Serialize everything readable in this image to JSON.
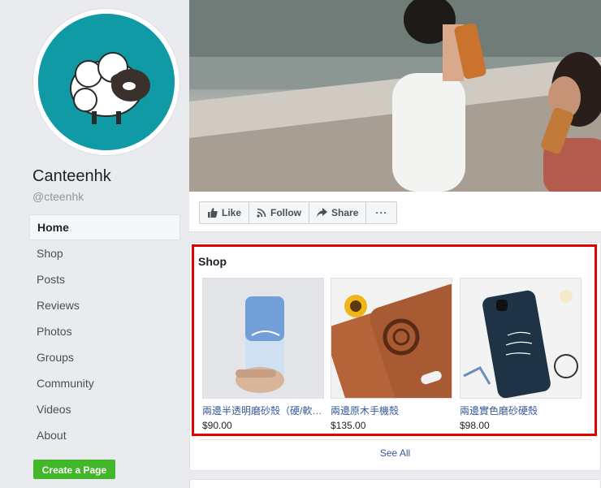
{
  "page": {
    "name": "Canteenhk",
    "handle": "@cteenhk"
  },
  "nav": {
    "items": [
      {
        "label": "Home",
        "active": true
      },
      {
        "label": "Shop"
      },
      {
        "label": "Posts"
      },
      {
        "label": "Reviews"
      },
      {
        "label": "Photos"
      },
      {
        "label": "Groups"
      },
      {
        "label": "Community"
      },
      {
        "label": "Videos"
      },
      {
        "label": "About"
      }
    ],
    "create_page_label": "Create a Page"
  },
  "actions": {
    "like_label": "Like",
    "follow_label": "Follow",
    "share_label": "Share",
    "more_label": "···"
  },
  "shop": {
    "title": "Shop",
    "products": [
      {
        "name": "兩邊半透明磨砂殼（硬/軟…",
        "price": "$90.00"
      },
      {
        "name": "兩邊原木手機殼",
        "price": "$135.00"
      },
      {
        "name": "兩邊實色磨砂硬殼",
        "price": "$98.00"
      }
    ],
    "see_all_label": "See All"
  },
  "colors": {
    "avatar_bg": "#0f9aa6",
    "link": "#365899",
    "create_page_green": "#42b72a",
    "highlight_red": "#e10000"
  },
  "icons": [
    "thumbs-up-icon",
    "rss-follow-icon",
    "share-arrow-icon",
    "more-dots-icon"
  ]
}
